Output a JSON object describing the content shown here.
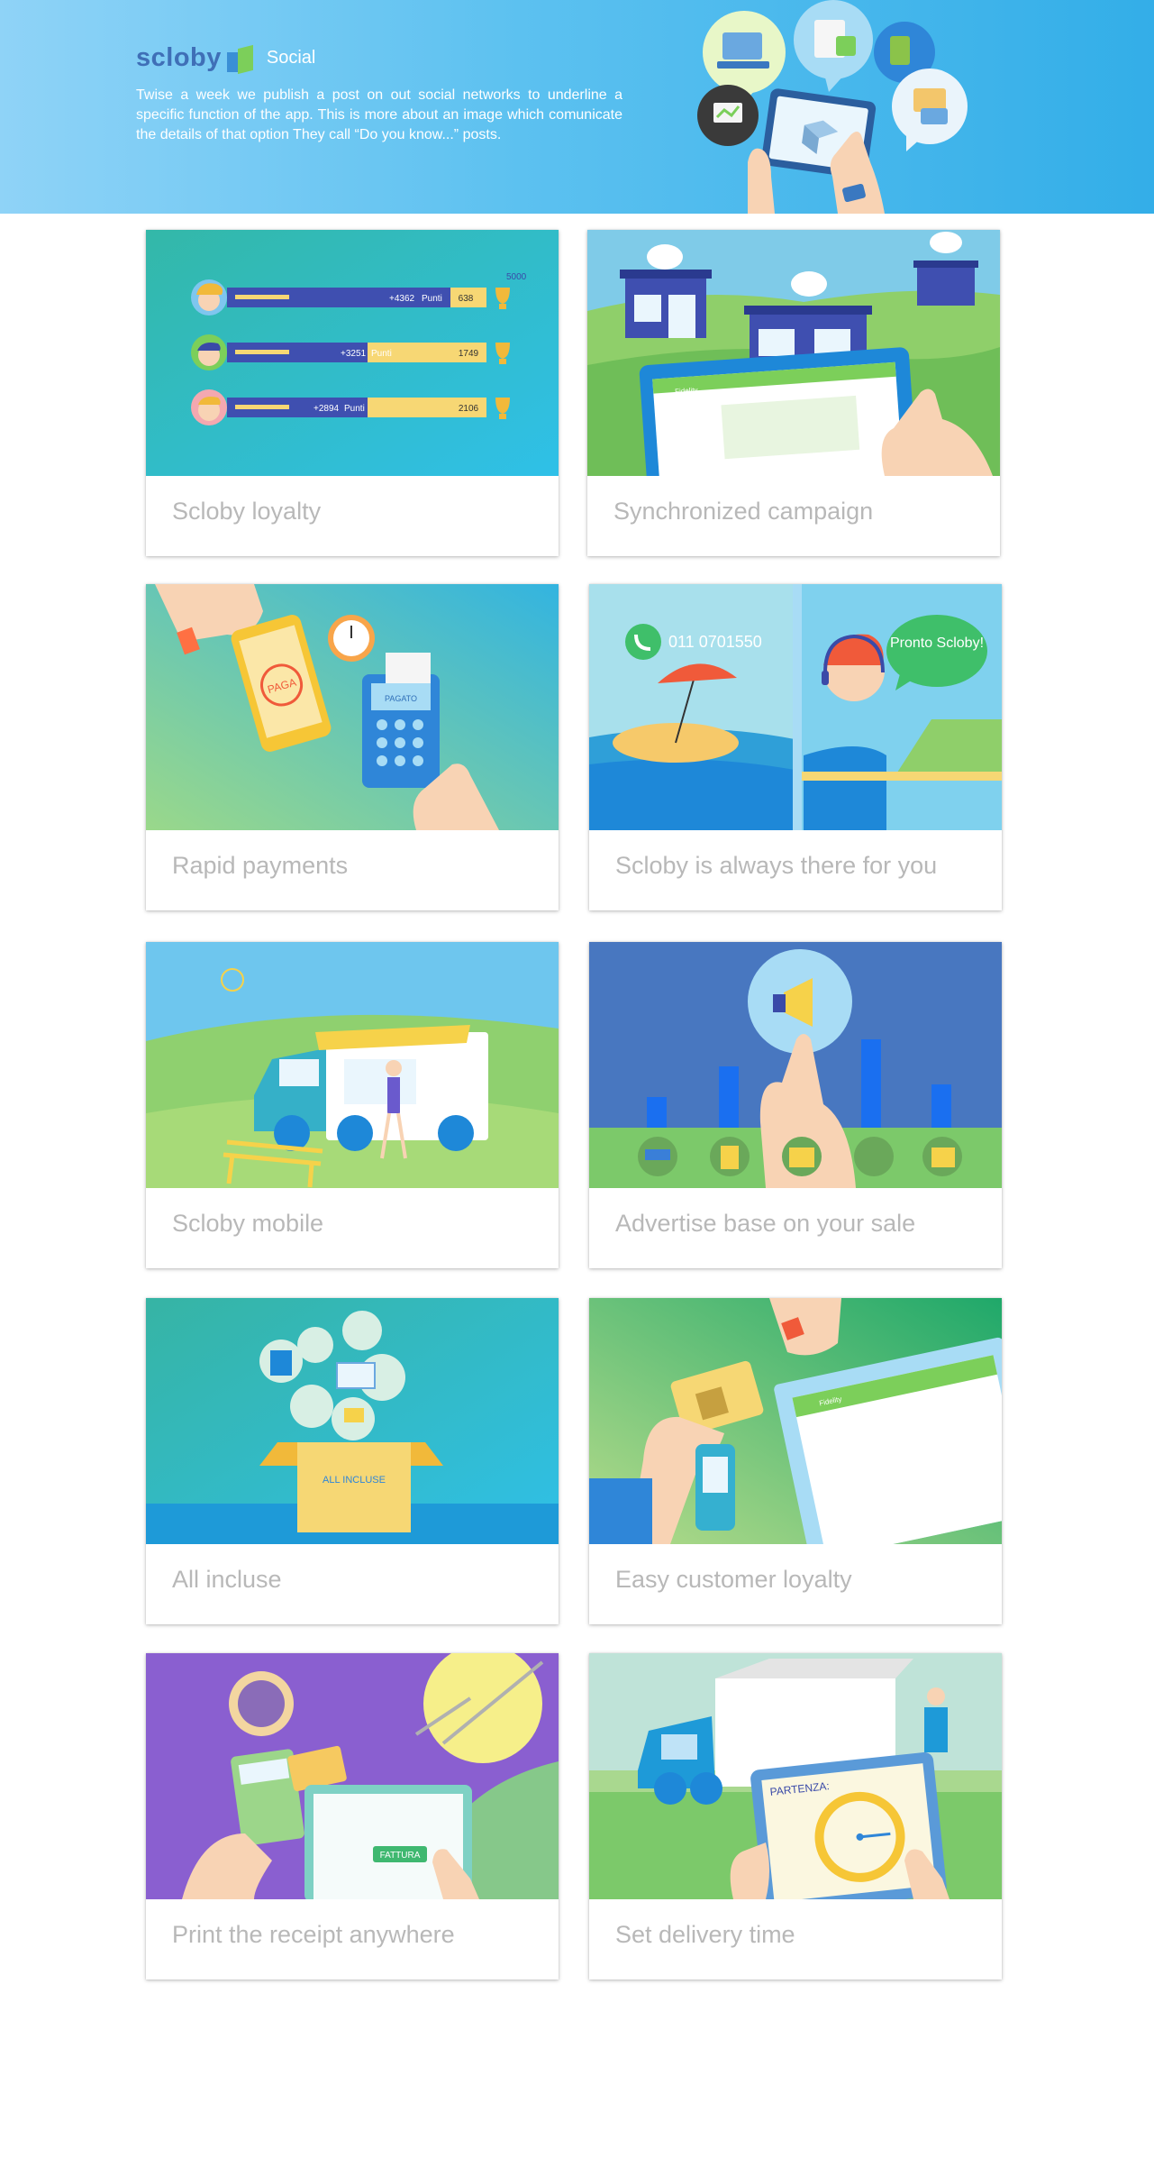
{
  "header": {
    "brand": "scloby",
    "section": "Social",
    "intro": "Twise a week we publish a post on out social networks to underline a specific function of the app. This is more about an image which comunicate the details of that option They call “Do you know...” posts."
  },
  "cards": [
    {
      "title": "Scloby loyalty",
      "illustration": "loyalty-leaderboard",
      "goal_label": "5000",
      "rows": [
        {
          "points": "+4362",
          "unit": "Punti",
          "total": "638"
        },
        {
          "points": "+3251",
          "unit": "Punti",
          "total": "1749"
        },
        {
          "points": "+2894",
          "unit": "Punti",
          "total": "2106"
        }
      ]
    },
    {
      "title": "Synchronized campaign",
      "illustration": "stores-tablet",
      "app_label": "Fidelity"
    },
    {
      "title": "Rapid payments",
      "illustration": "phone-payment",
      "pay_label": "PAGA",
      "terminal_label": "PAGATO"
    },
    {
      "title": "Scloby is always there for you",
      "illustration": "support-call",
      "phone": "011 0701550",
      "speech": "Pronto Scloby!"
    },
    {
      "title": "Scloby mobile",
      "illustration": "food-truck"
    },
    {
      "title": "Advertise base on your sale",
      "illustration": "megaphone-bars"
    },
    {
      "title": "All incluse",
      "illustration": "box-all-incluse",
      "box_label": "ALL INCLUSE"
    },
    {
      "title": "Easy customer loyalty",
      "illustration": "card-scan-tablet",
      "app_label": "Fidelity"
    },
    {
      "title": "Print the receipt anywhere",
      "illustration": "table-receipt",
      "button_label": "FATTURA"
    },
    {
      "title": "Set delivery time",
      "illustration": "delivery-clock",
      "tablet_label": "PARTENZA:"
    }
  ],
  "colors": {
    "header_start": "#8fd3f7",
    "header_end": "#33aee8",
    "brand": "#3f6fb7",
    "card_title": "#b8b8b8"
  }
}
